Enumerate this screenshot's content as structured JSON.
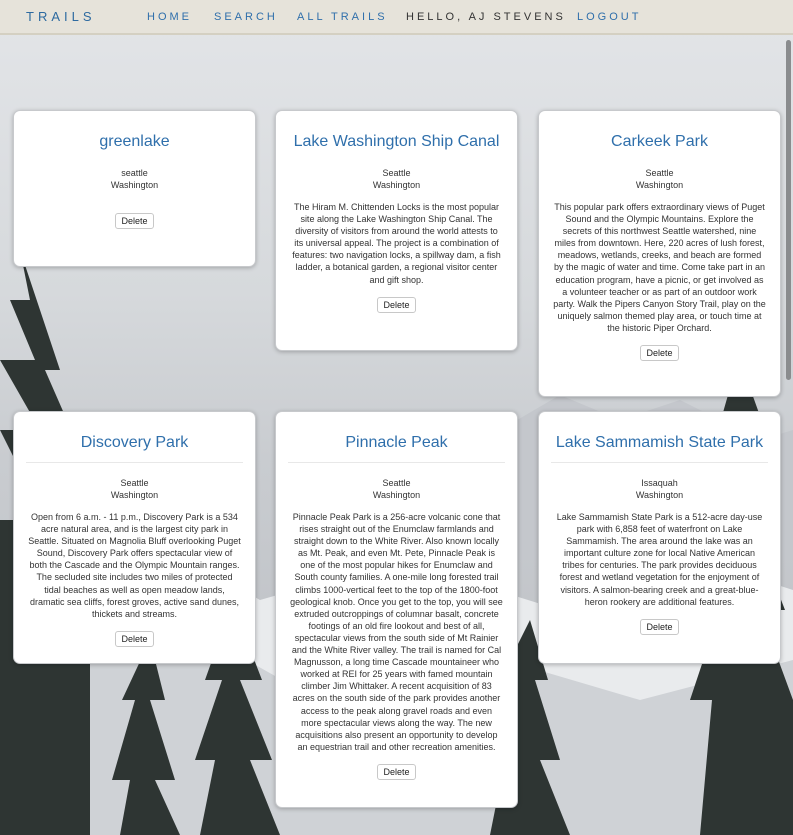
{
  "nav": {
    "brand": "TRAILS",
    "home": "HOME",
    "search": "SEARCH",
    "all_trails": "ALL TRAILS",
    "greeting": "HELLO, AJ STEVENS",
    "logout": "LOGOUT"
  },
  "colors": {
    "accent": "#2f6fab",
    "navbar": "#e6e3da"
  },
  "trails": [
    {
      "name": "greenlake",
      "city": "seattle",
      "state": "Washington",
      "description": "",
      "delete_label": "Delete"
    },
    {
      "name": "Lake Washington Ship Canal",
      "city": "Seattle",
      "state": "Washington",
      "description": "The Hiram M. Chittenden Locks is the most popular site along the Lake Washington Ship Canal. The diversity of visitors from around the world attests to its universal appeal. The project is a combination of features: two navigation locks, a spillway dam, a fish ladder, a botanical garden, a regional visitor center and gift shop.",
      "delete_label": "Delete"
    },
    {
      "name": "Carkeek Park",
      "city": "Seattle",
      "state": "Washington",
      "description": "This popular park offers extraordinary views of Puget Sound and the Olympic Mountains. Explore the secrets of this northwest Seattle watershed, nine miles from downtown. Here, 220 acres of lush forest, meadows, wetlands, creeks, and beach are formed by the magic of water and time. Come take part in an education program, have a picnic, or get involved as a volunteer teacher or as part of an outdoor work party. Walk the Pipers Canyon Story Trail, play on the uniquely salmon themed play area, or touch time at the historic Piper Orchard.",
      "delete_label": "Delete"
    },
    {
      "name": "Discovery Park",
      "city": "Seattle",
      "state": "Washington",
      "description": "Open from 6 a.m. - 11 p.m., Discovery Park is a 534 acre natural area, and is the largest city park in Seattle. Situated on Magnolia Bluff overlooking Puget Sound, Discovery Park offers spectacular view of both the Cascade and the Olympic Mountain ranges. The secluded site includes two miles of protected tidal beaches as well as open meadow lands, dramatic sea cliffs, forest groves, active sand dunes, thickets and streams.",
      "delete_label": "Delete"
    },
    {
      "name": "Pinnacle Peak",
      "city": "Seattle",
      "state": "Washington",
      "description": "Pinnacle Peak Park is a 256-acre volcanic cone that rises straight out of the Enumclaw farmlands and straight down to the White River. Also known locally as Mt. Peak, and even Mt. Pete, Pinnacle Peak is one of the most popular hikes for Enumclaw and South county families. A one-mile long forested trail climbs 1000-vertical feet to the top of the 1800-foot geological knob. Once you get to the top, you will see extruded outcroppings of columnar basalt, concrete footings of an old fire lookout and best of all, spectacular views from the south side of Mt Rainier and the White River valley. The trail is named for Cal Magnusson, a long time Cascade mountaineer who worked at REI for 25 years with famed mountain climber Jim Whittaker. A recent acquisition of 83 acres on the south side of the park provides another access to the peak along gravel roads and even more spectacular views along the way. The new acquisitions also present an opportunity to develop an equestrian trail and other recreation amenities.",
      "delete_label": "Delete"
    },
    {
      "name": "Lake Sammamish State Park",
      "city": "Issaquah",
      "state": "Washington",
      "description": "Lake Sammamish State Park is a 512-acre day-use park with 6,858 feet of waterfront on Lake Sammamish. The area around the lake was an important culture zone for local Native American tribes for centuries. The park provides deciduous forest and wetland vegetation for the enjoyment of visitors. A salmon-bearing creek and a great-blue-heron rookery are additional features.",
      "delete_label": "Delete"
    }
  ]
}
